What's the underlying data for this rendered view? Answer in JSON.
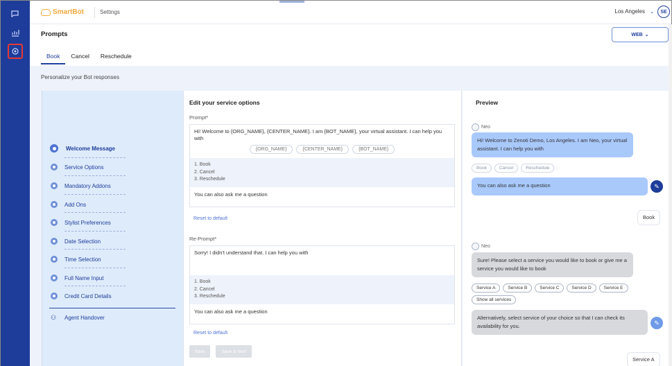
{
  "app": {
    "logo": "SmartBot",
    "section": "Settings",
    "location": "Los Angeles",
    "avatar_initials": "SE"
  },
  "page": {
    "title": "Prompts",
    "channel_button": "WEB",
    "subtitle": "Personalize your Bot responses"
  },
  "tabs": [
    "Book",
    "Cancel",
    "Reschedule"
  ],
  "steps": [
    {
      "label": "Welcome Message"
    },
    {
      "label": "Service Options"
    },
    {
      "label": "Mandatory Addons"
    },
    {
      "label": "Add Ons"
    },
    {
      "label": "Stylist Preferences"
    },
    {
      "label": "Date Selection"
    },
    {
      "label": "Time Selection"
    },
    {
      "label": "Full Name Input"
    },
    {
      "label": "Credit Card Details"
    }
  ],
  "handover": "Agent Handover",
  "editor": {
    "title": "Edit your service options",
    "prompt_label": "Prompt*",
    "prompt_text": "Hi! Welcome to {ORG_NAME}, {CENTER_NAME}. I am {BOT_NAME}, your virtual assistant. I can help you with",
    "chips": [
      "{ORG_NAME}",
      "{CENTER_NAME}",
      "{BOT_NAME}"
    ],
    "options": [
      "1. Book",
      "2. Cancel",
      "3. Reschedule"
    ],
    "ask_text": "You can also ask me a question",
    "reset_1": "Reset to default",
    "reprompt_label": "Re-Prompt*",
    "reprompt_text": "Sorry! I didn't understand that. I can help you with",
    "reprompt_options": [
      "1. Book",
      "2. Cancel",
      "3. Reschedule"
    ],
    "reprompt_ask": "You can also ask me a question",
    "reset_2": "Reset to default",
    "save": "Save",
    "save_next": "Save & next"
  },
  "preview": {
    "title": "Preview",
    "bot_name": "Neo",
    "welcome": "Hi! Welcome to Zenoti Demo, Los Angeles. I am Neo, your virtual assistant. I can help you with",
    "quick_replies": [
      "Book",
      "Cancel",
      "Reschedule"
    ],
    "ask": "You can also ask me a question",
    "user_reply": "Book",
    "bot_name_2": "Neo",
    "service_prompt": "Sure! Please select a service you would like to book or give me a service you would like to book",
    "services": [
      "Service A",
      "Service B",
      "Service C",
      "Service D",
      "Service E",
      "Show all services"
    ],
    "alternative": "Alternatively, select service of your choice so that I can check its availability for you.",
    "user_reply_2": "Service A"
  }
}
